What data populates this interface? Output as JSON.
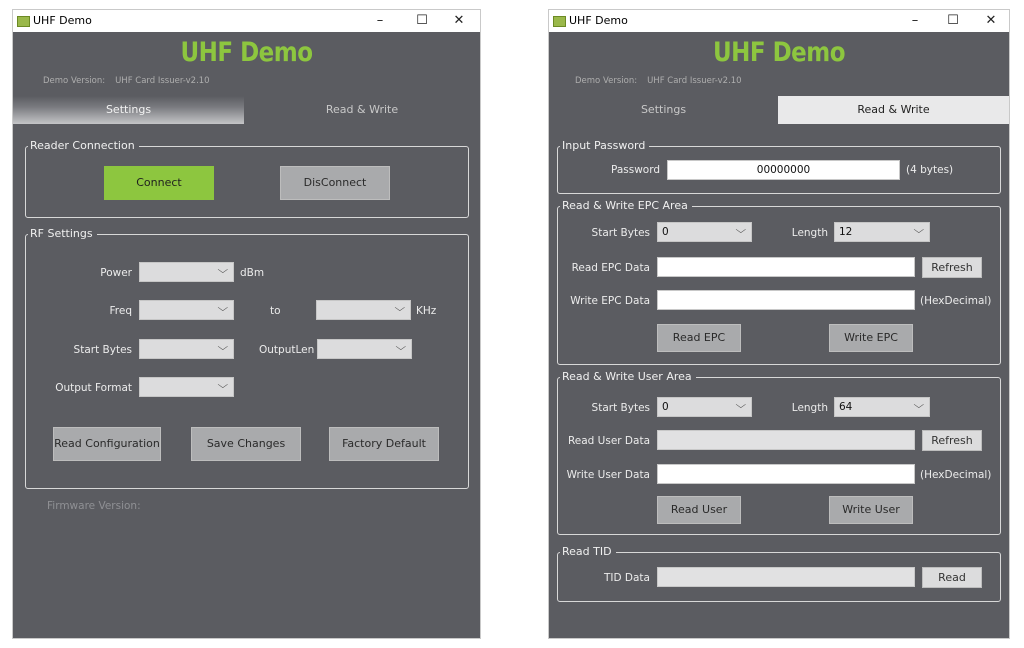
{
  "left_window": {
    "title": "UHF Demo",
    "brand": "UHF Demo",
    "version_label": "Demo Version:",
    "version_value": "UHF Card Issuer-v2.10",
    "tabs": [
      "Settings",
      "Read & Write"
    ],
    "active_tab": "Settings",
    "reader_connection": {
      "legend": "Reader Connection",
      "connect": "Connect",
      "disconnect": "DisConnect"
    },
    "rf_settings": {
      "legend": "RF Settings",
      "power_label": "Power",
      "power_unit": "dBm",
      "freq_label": "Freq",
      "to_label": "to",
      "freq_unit": "KHz",
      "start_bytes_label": "Start Bytes",
      "output_len_label": "OutputLen",
      "output_format_label": "Output Format",
      "read_config": "Read Configuration",
      "save_changes": "Save Changes",
      "factory_default": "Factory Default"
    },
    "firmware_label": "Firmware Version:"
  },
  "right_window": {
    "title": "UHF Demo",
    "brand": "UHF Demo",
    "version_label": "Demo Version:",
    "version_value": "UHF Card Issuer-v2.10",
    "tabs": [
      "Settings",
      "Read & Write"
    ],
    "active_tab": "Read & Write",
    "password": {
      "legend": "Input Password",
      "label": "Password",
      "value": "00000000",
      "hint": "(4 bytes)"
    },
    "epc": {
      "legend": "Read & Write EPC Area",
      "start_bytes_label": "Start Bytes",
      "start_bytes_value": "0",
      "length_label": "Length",
      "length_value": "12",
      "read_label": "Read EPC Data",
      "read_value": "",
      "refresh": "Refresh",
      "write_label": "Write EPC Data",
      "write_value": "",
      "hex_hint": "(HexDecimal)",
      "read_button": "Read EPC",
      "write_button": "Write EPC"
    },
    "user": {
      "legend": "Read & Write User Area",
      "start_bytes_label": "Start Bytes",
      "start_bytes_value": "0",
      "length_label": "Length",
      "length_value": "64",
      "read_label": "Read User Data",
      "read_value": "",
      "refresh": "Refresh",
      "write_label": "Write User Data",
      "write_value": "",
      "hex_hint": "(HexDecimal)",
      "read_button": "Read User",
      "write_button": "Write User"
    },
    "tid": {
      "legend": "Read TID",
      "label": "TID Data",
      "value": "",
      "read_button": "Read"
    }
  },
  "window_controls": {
    "minimize": "–",
    "maximize": "☐",
    "close": "✕"
  },
  "colors": {
    "background": "#5b5c61",
    "accent": "#8dc63f",
    "button": "#a9aaac"
  }
}
